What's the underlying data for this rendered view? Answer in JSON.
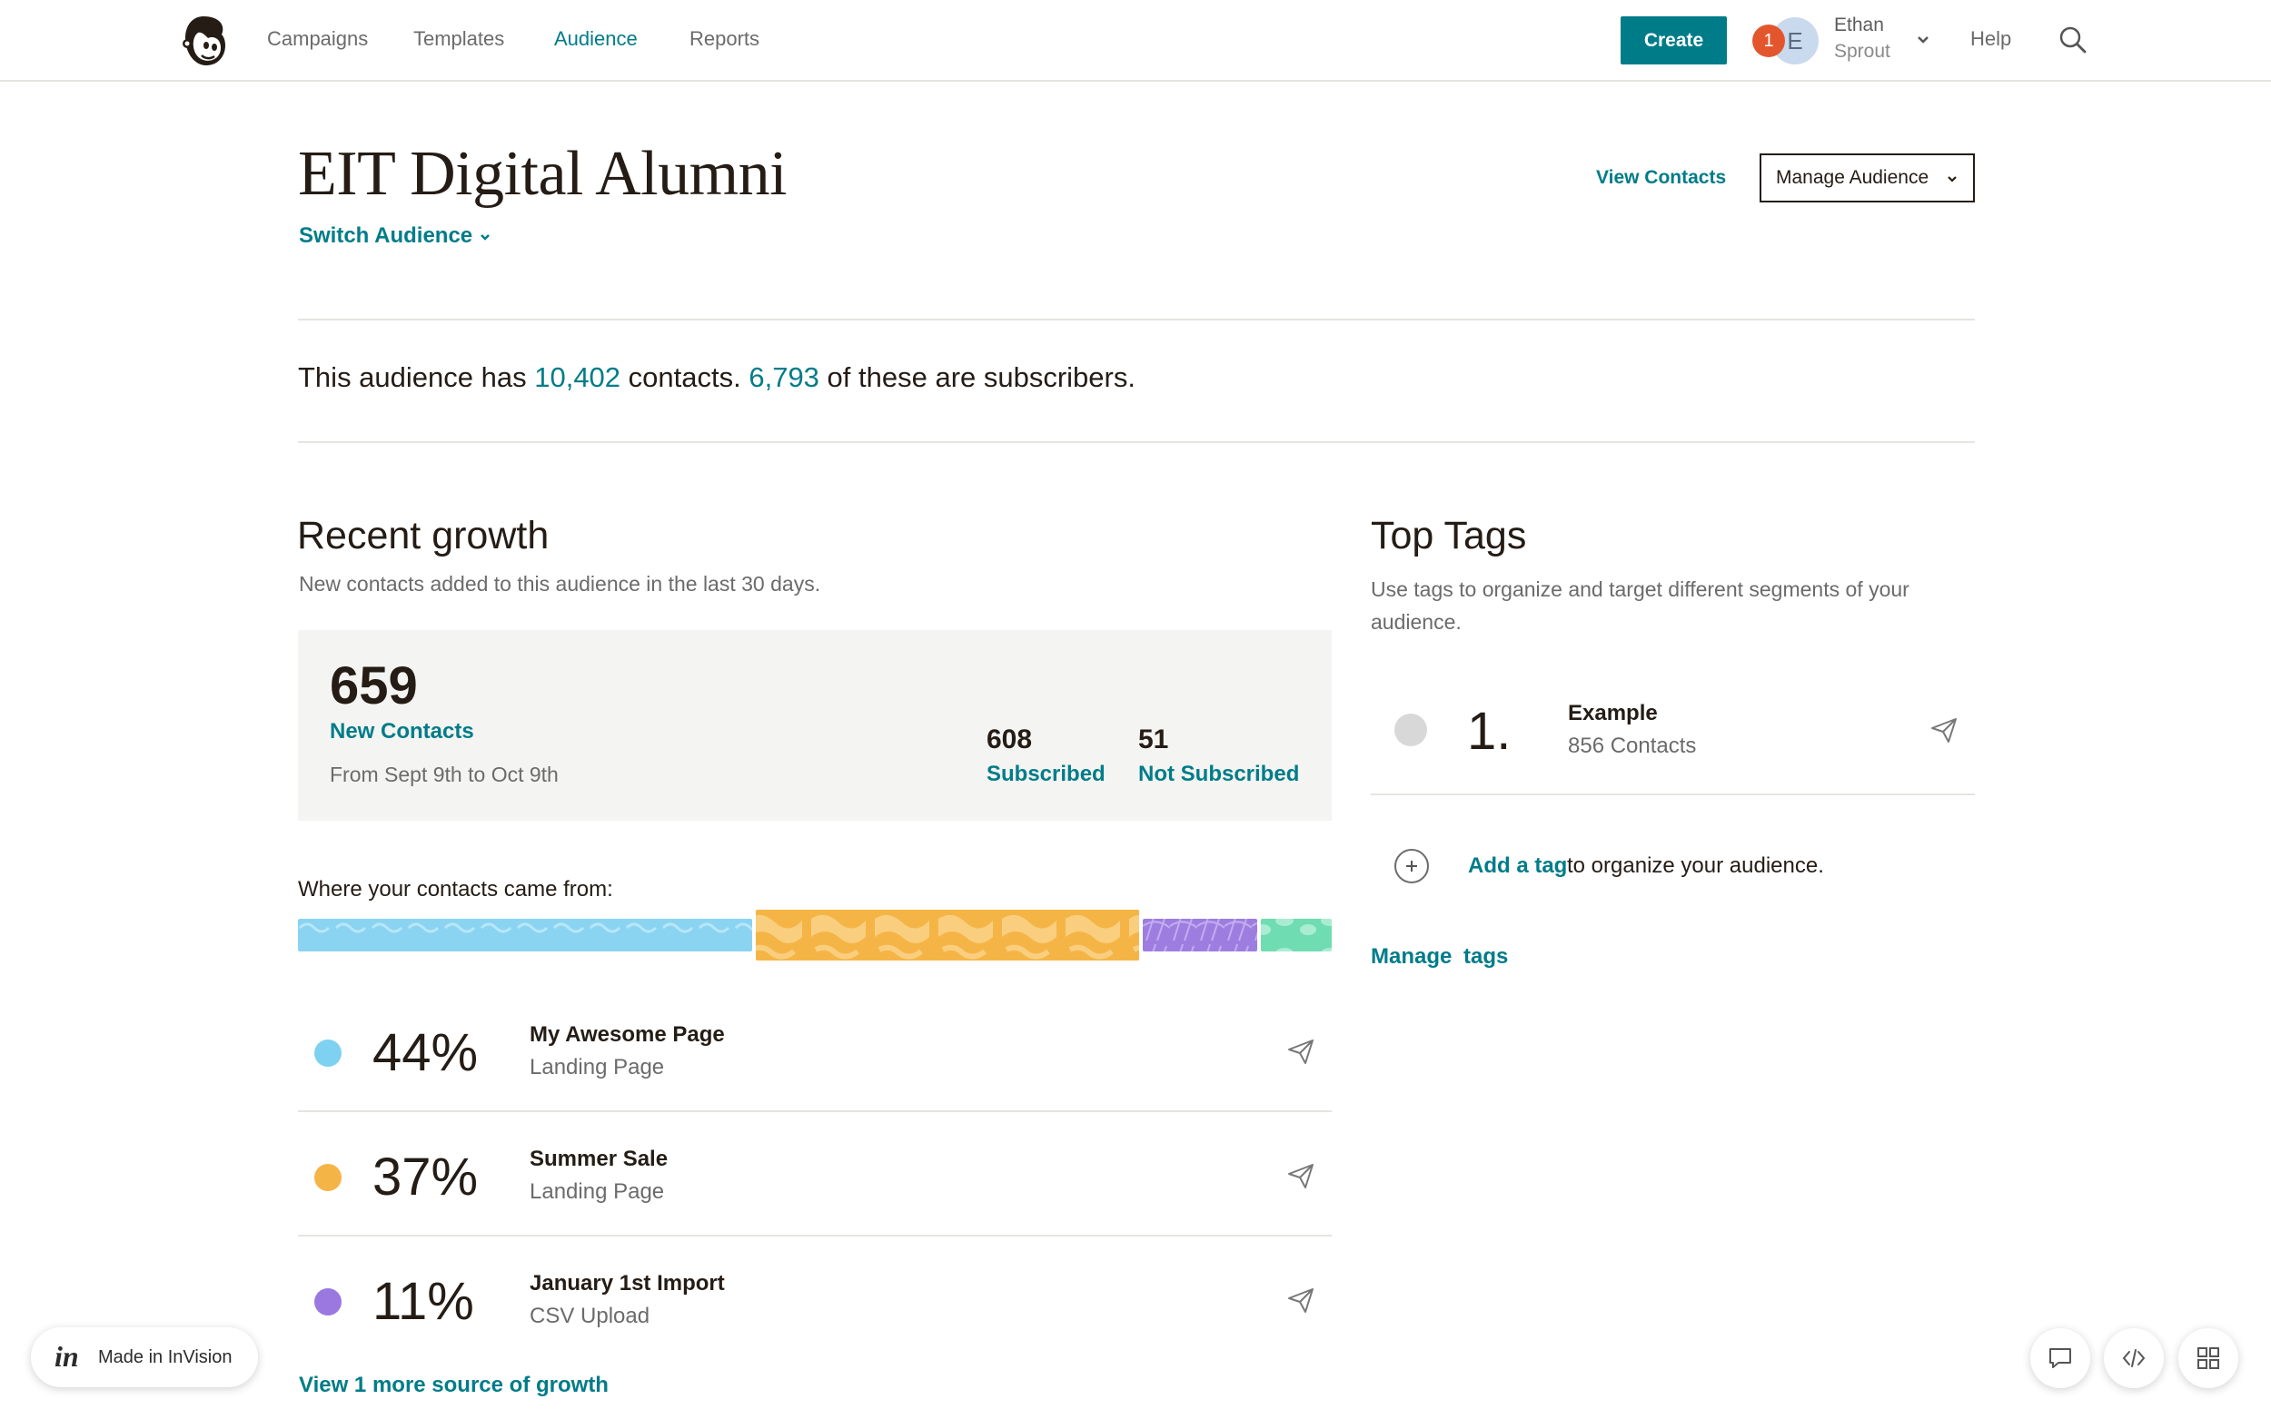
{
  "nav": {
    "items": [
      {
        "label": "Campaigns",
        "active": false
      },
      {
        "label": "Templates",
        "active": false
      },
      {
        "label": "Audience",
        "active": true
      },
      {
        "label": "Reports",
        "active": false
      }
    ],
    "create_label": "Create",
    "notification_count": "1",
    "avatar_initial": "E",
    "user_first_name": "Ethan",
    "user_last_name": "Sprout",
    "help_label": "Help",
    "icons": [
      "mailchimp-logo-icon",
      "chevron-down-icon",
      "search-icon"
    ]
  },
  "header": {
    "title": "EIT Digital Alumni",
    "switch_label": "Switch Audience",
    "view_contacts_label": "View Contacts",
    "manage_label": "Manage Audience"
  },
  "summary": {
    "prefix": "This audience has ",
    "contacts": "10,402",
    "middle": " contacts. ",
    "subscribers": "6,793",
    "suffix": " of these are subscribers."
  },
  "growth": {
    "title": "Recent growth",
    "subtitle": "New contacts added to this audience in the last 30 days.",
    "new_count": "659",
    "new_label": "New Contacts",
    "date_range": "From Sept 9th to Oct 9th",
    "subscribed_count": "608",
    "subscribed_label": "Subscribed",
    "not_subscribed_count": "51",
    "not_subscribed_label": "Not Subscribed",
    "where_label": "Where your contacts came from:",
    "sources": [
      {
        "percent": "44%",
        "share": 44,
        "name": "My Awesome Page",
        "type": "Landing Page",
        "color": "#7fd1f1"
      },
      {
        "percent": "37%",
        "share": 37,
        "name": "Summer Sale",
        "type": "Landing Page",
        "color": "#f5b546"
      },
      {
        "percent": "11%",
        "share": 11,
        "name": "January 1st Import",
        "type": "CSV Upload",
        "color": "#9b78e0"
      }
    ],
    "fourth_source_color": "#6fdcb2",
    "view_more_label": "View 1 more source of growth"
  },
  "tags": {
    "title": "Top Tags",
    "subtitle": "Use tags to organize and target different segments of your audience.",
    "items": [
      {
        "rank": "1.",
        "name": "Example",
        "count": "856 Contacts"
      }
    ],
    "add_link": "Add a tag",
    "add_rest": " to organize your audience.",
    "manage_label": "Manage tags"
  },
  "invision": {
    "logo": "in",
    "label": "Made in InVision"
  },
  "colors": {
    "accent": "#007c89",
    "notification": "#e3562d",
    "box_bg": "#f4f4f2"
  }
}
